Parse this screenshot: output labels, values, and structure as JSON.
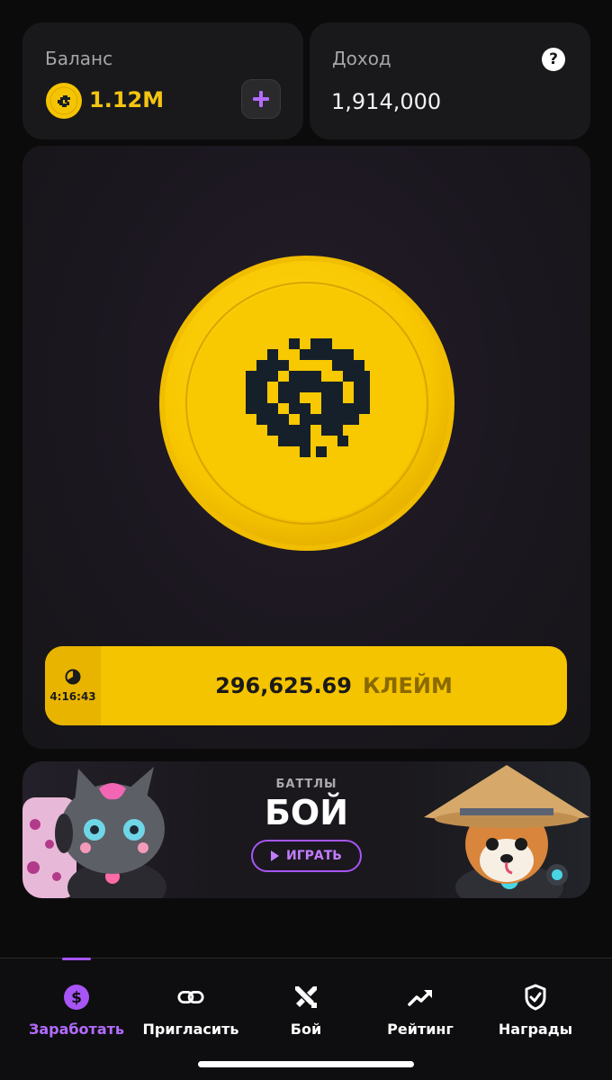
{
  "balance": {
    "label": "Баланс",
    "value": "1.12M",
    "add_button": "+",
    "coin_icon": "coin-icon"
  },
  "income": {
    "label": "Доход",
    "value": "1,914,000",
    "help_icon": "?"
  },
  "tap": {
    "coin_icon": "spiral-coin-icon"
  },
  "claim": {
    "timer": "4:16:43",
    "amount": "296,625.69",
    "label": "КЛЕЙМ"
  },
  "battle": {
    "subtitle": "БАТТЛЫ",
    "title": "БОЙ",
    "play_label": "ИГРАТЬ"
  },
  "nav": {
    "items": [
      {
        "label": "Заработать",
        "icon": "dollar-icon",
        "active": true
      },
      {
        "label": "Пригласить",
        "icon": "link-icon",
        "active": false
      },
      {
        "label": "Бой",
        "icon": "swords-icon",
        "active": false
      },
      {
        "label": "Рейтинг",
        "icon": "trend-icon",
        "active": false
      },
      {
        "label": "Награды",
        "icon": "badge-icon",
        "active": false
      }
    ]
  },
  "colors": {
    "accent": "#a855f7",
    "coin": "#f5c400",
    "background": "#0b0b0c"
  }
}
